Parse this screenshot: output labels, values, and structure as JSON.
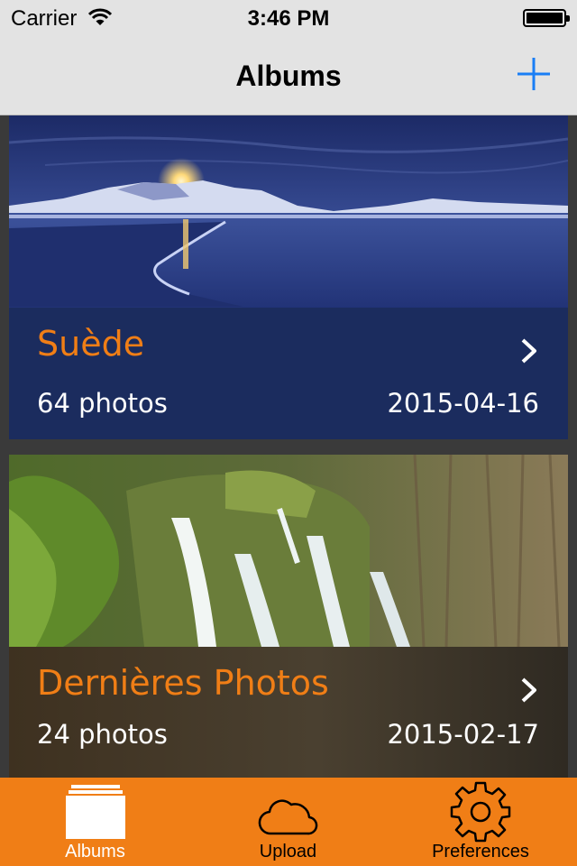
{
  "status_bar": {
    "carrier": "Carrier",
    "time": "3:46 PM",
    "wifi_icon": "wifi-icon",
    "battery_icon": "battery-full-icon"
  },
  "nav_bar": {
    "title": "Albums",
    "add_icon": "plus-icon"
  },
  "albums": [
    {
      "title": "Suède",
      "count": "64 photos",
      "date": "2015-04-16",
      "chevron_icon": "chevron-right-icon"
    },
    {
      "title": "Dernières Photos",
      "count": "24 photos",
      "date": "2015-02-17",
      "chevron_icon": "chevron-right-icon"
    }
  ],
  "tab_bar": {
    "tabs": [
      {
        "label": "Albums",
        "icon": "albums-stack-icon",
        "selected": true
      },
      {
        "label": "Upload",
        "icon": "cloud-icon",
        "selected": false
      },
      {
        "label": "Preferences",
        "icon": "gear-icon",
        "selected": false
      }
    ]
  },
  "colors": {
    "accent": "#f07e16",
    "bar_background": "#e3e3e3",
    "list_background": "#3a3a3a",
    "link_blue": "#1a7ef5"
  }
}
